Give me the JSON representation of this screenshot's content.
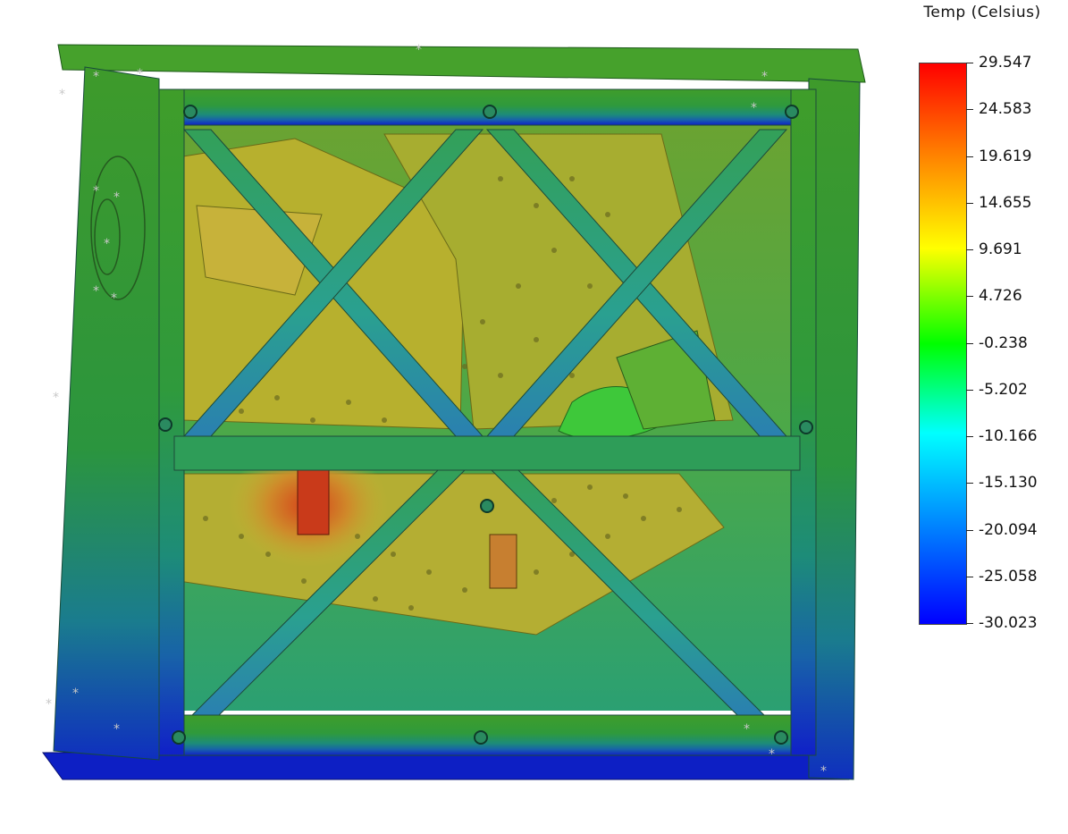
{
  "legend": {
    "title": "Temp (Celsius)",
    "labels": [
      "29.547",
      "24.583",
      "19.619",
      "14.655",
      "9.691",
      "4.726",
      "-0.238",
      "-5.202",
      "-10.166",
      "-15.130",
      "-20.094",
      "-25.058",
      "-30.023"
    ]
  }
}
